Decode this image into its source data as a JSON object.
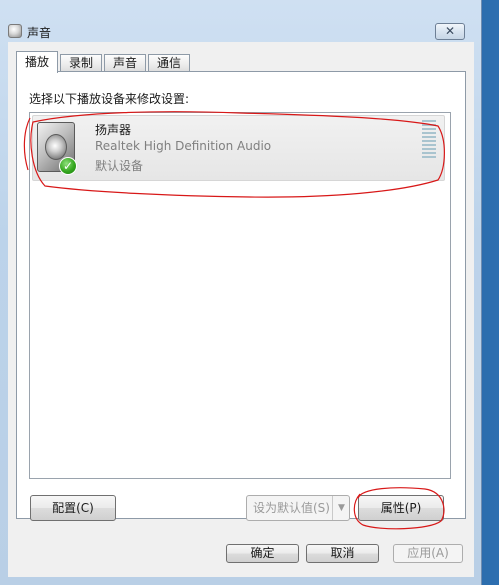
{
  "window": {
    "title": "声音",
    "close_glyph": "✕"
  },
  "tabs": [
    {
      "label": "播放",
      "active": true
    },
    {
      "label": "录制",
      "active": false
    },
    {
      "label": "声音",
      "active": false
    },
    {
      "label": "通信",
      "active": false
    }
  ],
  "playback": {
    "instruction": "选择以下播放设备来修改设置:",
    "devices": [
      {
        "name": "扬声器",
        "driver": "Realtek High Definition Audio",
        "status": "默认设备",
        "icon": "speaker-icon",
        "badge_icon": "green-check-icon",
        "badge_glyph": "✓"
      }
    ]
  },
  "buttons": {
    "configure": "配置(C)",
    "set_default": "设为默认值(S)",
    "set_default_arrow": "▼",
    "properties": "属性(P)",
    "ok": "确定",
    "cancel": "取消",
    "apply": "应用(A)"
  },
  "colors": {
    "annotation": "#d81818",
    "meter": "#a9c4cf",
    "check": "#35a71f"
  }
}
